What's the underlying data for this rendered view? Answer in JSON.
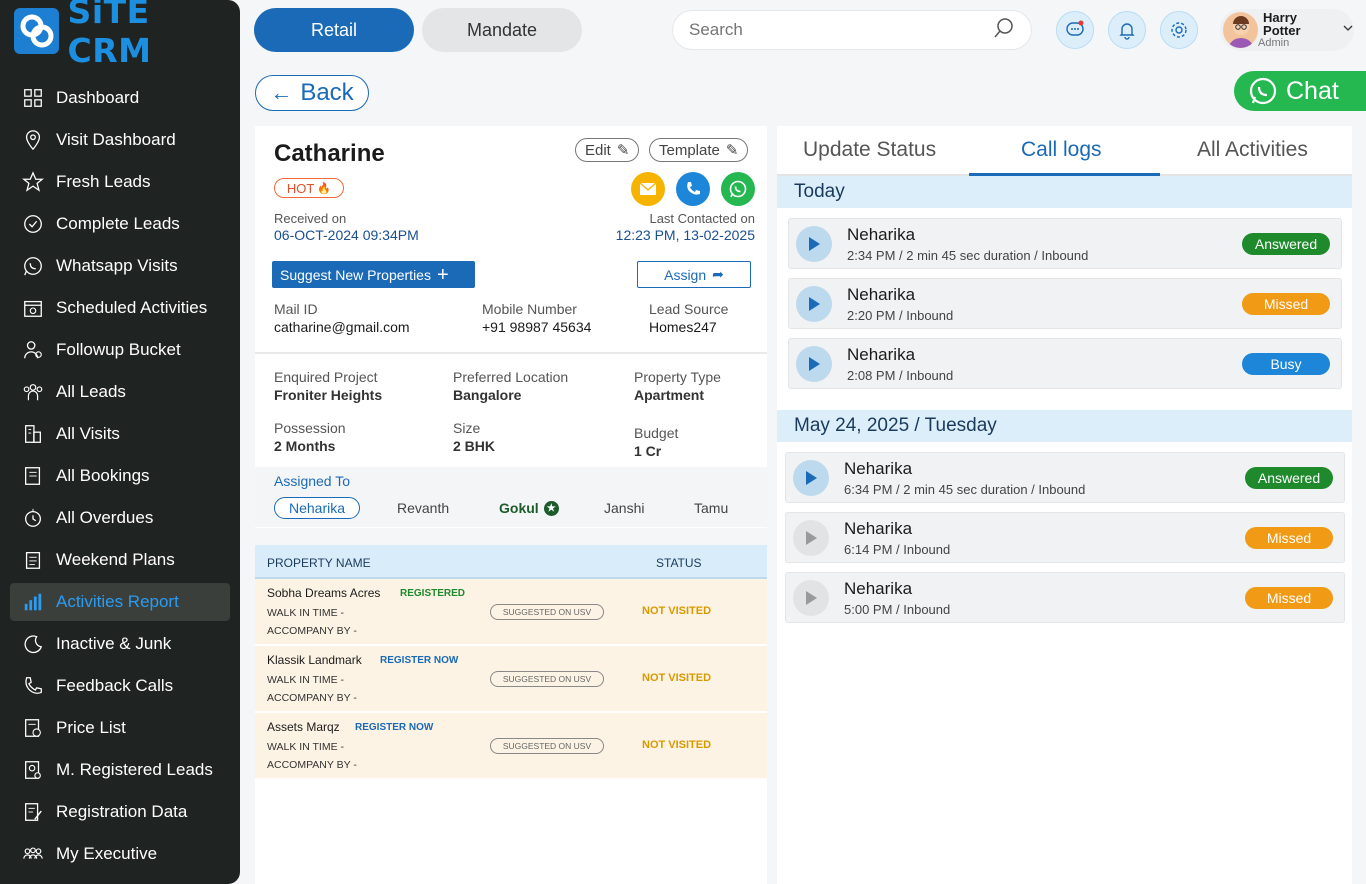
{
  "app": {
    "logo_text": "SiTE CRM"
  },
  "sidebar": {
    "items": [
      {
        "label": "Dashboard",
        "icon": "dashboard-icon"
      },
      {
        "label": "Visit Dashboard",
        "icon": "location-icon"
      },
      {
        "label": "Fresh Leads",
        "icon": "star-icon"
      },
      {
        "label": "Complete Leads",
        "icon": "check-circle-icon"
      },
      {
        "label": "Whatsapp Visits",
        "icon": "whatsapp-icon"
      },
      {
        "label": "Scheduled Activities",
        "icon": "calendar-icon"
      },
      {
        "label": "Followup Bucket",
        "icon": "followup-icon"
      },
      {
        "label": "All Leads",
        "icon": "users-icon"
      },
      {
        "label": "All Visits",
        "icon": "building-icon"
      },
      {
        "label": "All Bookings",
        "icon": "book-icon"
      },
      {
        "label": "All Overdues",
        "icon": "overdue-icon"
      },
      {
        "label": "Weekend Plans",
        "icon": "clipboard-icon"
      },
      {
        "label": "Activities Report",
        "icon": "bar-chart-icon",
        "active": true
      },
      {
        "label": "Inactive & Junk",
        "icon": "moon-icon"
      },
      {
        "label": "Feedback Calls",
        "icon": "phone-icon"
      },
      {
        "label": "Price List",
        "icon": "price-icon"
      },
      {
        "label": "M. Registered Leads",
        "icon": "registered-icon"
      },
      {
        "label": "Registration Data",
        "icon": "document-edit-icon"
      },
      {
        "label": "My Executive",
        "icon": "team-icon"
      }
    ]
  },
  "topbar": {
    "tabs": [
      "Retail",
      "Mandate"
    ],
    "search_placeholder": "Search",
    "user": {
      "name": "Harry Potter",
      "role": "Admin"
    }
  },
  "back_label": "Back",
  "chat_label": "Chat",
  "lead": {
    "name": "Catharine",
    "edit_label": "Edit",
    "template_label": "Template",
    "priority": "HOT",
    "received_label": "Received on",
    "received_value": "06-OCT-2024 09:34PM",
    "last_contacted_label": "Last Contacted on",
    "last_contacted_value": "12:23 PM, 13-02-2025",
    "suggest_label": "Suggest New Properties",
    "assign_label": "Assign",
    "mail_label": "Mail ID",
    "mail_value": "catharine@gmail.com",
    "mobile_label": "Mobile Number",
    "mobile_value": "+91 98987 45634",
    "source_label": "Lead Source",
    "source_value": "Homes247",
    "project_label": "Enquired Project",
    "project_value": "Froniter Heights",
    "location_label": "Preferred Location",
    "location_value": "Bangalore",
    "ptype_label": "Property Type",
    "ptype_value": "Apartment",
    "possession_label": "Possession",
    "possession_value": "2 Months",
    "size_label": "Size",
    "size_value": "2 BHK",
    "budget_label": "Budget",
    "budget_value": "1 Cr",
    "assigned_label": "Assigned To",
    "executives": [
      "Neharika",
      "Revanth",
      "Gokul",
      "Janshi",
      "Tamu"
    ]
  },
  "properties": {
    "headers": {
      "name": "PROPERTY NAME",
      "status": "STATUS"
    },
    "rows": [
      {
        "name": "Sobha Dreams Acres",
        "tag": "REGISTERED",
        "tag_color": "#1e8a2c",
        "walk": "WALK IN TIME -",
        "accompany": "ACCOMPANY BY -",
        "suggested": "SUGGESTED ON USV",
        "status": "NOT VISITED"
      },
      {
        "name": "Klassik Landmark",
        "tag": "REGISTER NOW",
        "tag_color": "#1a6ab7",
        "walk": "WALK IN TIME -",
        "accompany": "ACCOMPANY BY -",
        "suggested": "SUGGESTED ON USV",
        "status": "NOT VISITED"
      },
      {
        "name": "Assets Marqz",
        "tag": "REGISTER NOW",
        "tag_color": "#1a6ab7",
        "walk": "WALK IN TIME -",
        "accompany": "ACCOMPANY BY -",
        "suggested": "SUGGESTED ON USV",
        "status": "NOT VISITED"
      }
    ]
  },
  "activity_tabs": [
    "Update Status",
    "Call logs",
    "All Activities"
  ],
  "call_groups": [
    {
      "date": "Today",
      "calls": [
        {
          "name": "Neharika",
          "meta": "2:34 PM / 2 min 45 sec duration / Inbound",
          "status": "Answered",
          "playable": true
        },
        {
          "name": "Neharika",
          "meta": "2:20 PM / Inbound",
          "status": "Missed",
          "playable": true
        },
        {
          "name": "Neharika",
          "meta": "2:08 PM / Inbound",
          "status": "Busy",
          "playable": true
        }
      ]
    },
    {
      "date": "May 24, 2025 / Tuesday",
      "calls": [
        {
          "name": "Neharika",
          "meta": "6:34 PM / 2 min 45 sec duration / Inbound",
          "status": "Answered",
          "playable": true
        },
        {
          "name": "Neharika",
          "meta": "6:14 PM / Inbound",
          "status": "Missed",
          "playable": false
        },
        {
          "name": "Neharika",
          "meta": "5:00 PM / Inbound",
          "status": "Missed",
          "playable": false
        }
      ]
    }
  ],
  "colors": {
    "primary": "#1a6ab7",
    "answered": "#1e8a2c",
    "missed": "#f09a16",
    "busy": "#1d86d9",
    "sidebar": "#1f2321"
  }
}
